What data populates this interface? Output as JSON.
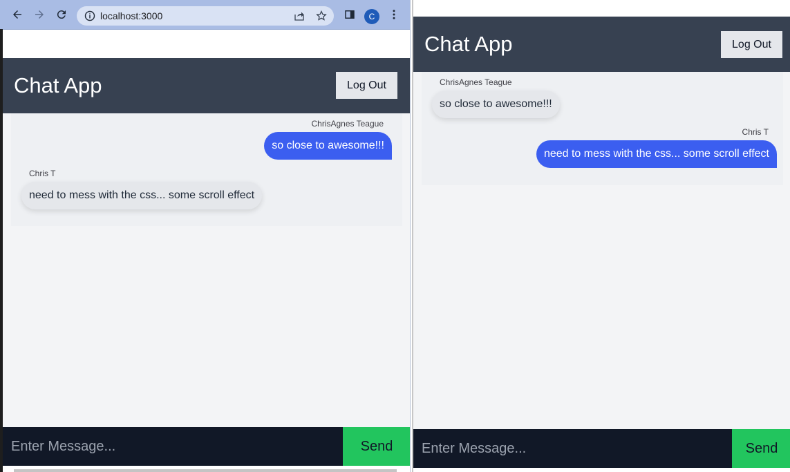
{
  "browser": {
    "url": "localhost:3000",
    "profile_initial": "C",
    "icons": [
      "back-icon",
      "forward-icon",
      "reload-icon",
      "site-info-icon",
      "share-icon",
      "star-icon",
      "side-panel-icon",
      "menu-icon"
    ]
  },
  "app": {
    "title": "Chat App",
    "logout_label": "Log Out",
    "input_placeholder": "Enter Message...",
    "send_label": "Send"
  },
  "left_window": {
    "messages": [
      {
        "sender": "ChrisAgnes Teague",
        "text": "so close to awesome!!!",
        "own": true
      },
      {
        "sender": "Chris T",
        "text": "need to mess with the css... some scroll effect",
        "own": false
      }
    ]
  },
  "right_window": {
    "messages": [
      {
        "sender": "ChrisAgnes Teague",
        "text": "so close to awesome!!!",
        "own": false
      },
      {
        "sender": "Chris T",
        "text": "need to mess with the css... some scroll effect",
        "own": true
      }
    ]
  },
  "colors": {
    "header": "#374151",
    "chat_background": "#f3f4f6",
    "own_bubble": "#3b5ef0",
    "other_bubble": "#e5e7eb",
    "input_bar": "#111827",
    "send_button": "#22c55e",
    "browser_toolbar": "#a9bce4"
  }
}
